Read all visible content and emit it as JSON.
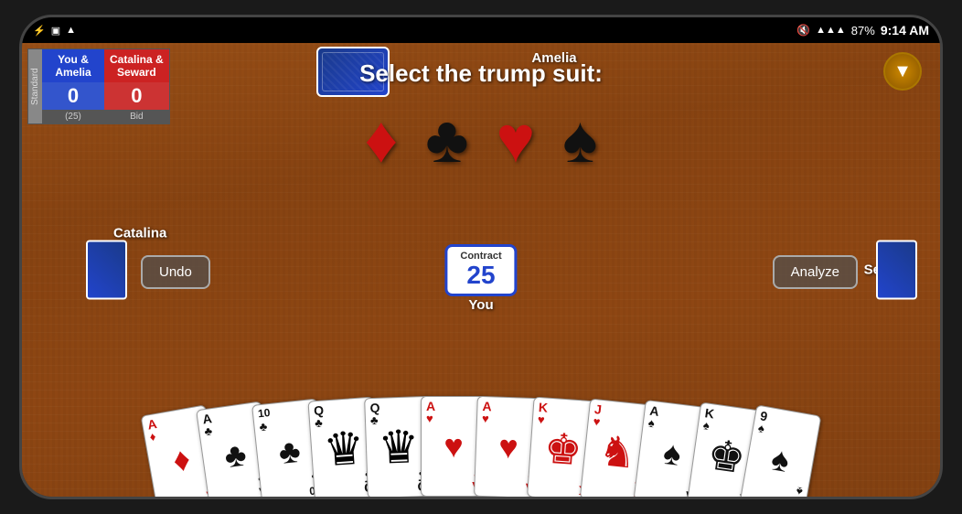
{
  "statusBar": {
    "time": "9:14 AM",
    "battery": "87%",
    "batteryIcon": "🔋",
    "wifiIcon": "📶",
    "signalIcon": "📡"
  },
  "scores": {
    "team1": {
      "name": "You &\nAmelia",
      "score": "0",
      "color": "blue"
    },
    "team2": {
      "name": "Catalina &\nSeward",
      "score": "0",
      "color": "red"
    },
    "bid": "Bid",
    "bidValue": "(25)"
  },
  "trumpPrompt": "Select the trump suit:",
  "suits": [
    {
      "symbol": "♦",
      "name": "diamonds",
      "color": "red"
    },
    {
      "symbol": "♣",
      "name": "clubs",
      "color": "black"
    },
    {
      "symbol": "♥",
      "name": "hearts",
      "color": "red"
    },
    {
      "symbol": "♠",
      "name": "spades",
      "color": "black"
    }
  ],
  "players": {
    "top": "Amelia",
    "left": "Catalina",
    "right": "Seward",
    "bottom": "You"
  },
  "contract": {
    "label": "Contract",
    "value": "25"
  },
  "buttons": {
    "undo": "Undo",
    "analyze": "Analyze"
  },
  "hand": [
    {
      "rank": "A",
      "suit": "♦",
      "color": "red",
      "face": false
    },
    {
      "rank": "A",
      "suit": "♣",
      "color": "black",
      "face": false
    },
    {
      "rank": "10",
      "suit": "♣",
      "color": "black",
      "face": false
    },
    {
      "rank": "Q",
      "suit": "♣",
      "color": "black",
      "face": true,
      "faceChar": "👸"
    },
    {
      "rank": "Q",
      "suit": "♣",
      "color": "black",
      "face": true,
      "faceChar": "👸"
    },
    {
      "rank": "A",
      "suit": "♥",
      "color": "red",
      "face": false
    },
    {
      "rank": "A",
      "suit": "♥",
      "color": "red",
      "face": false
    },
    {
      "rank": "K",
      "suit": "♥",
      "color": "red",
      "face": true,
      "faceChar": "🤴"
    },
    {
      "rank": "J",
      "suit": "♥",
      "color": "red",
      "face": true,
      "faceChar": "🃏"
    },
    {
      "rank": "A",
      "suit": "♠",
      "color": "black",
      "face": false
    },
    {
      "rank": "K",
      "suit": "♠",
      "color": "black",
      "face": true,
      "faceChar": "🤴"
    },
    {
      "rank": "9",
      "suit": "♠",
      "color": "black",
      "face": false
    }
  ]
}
